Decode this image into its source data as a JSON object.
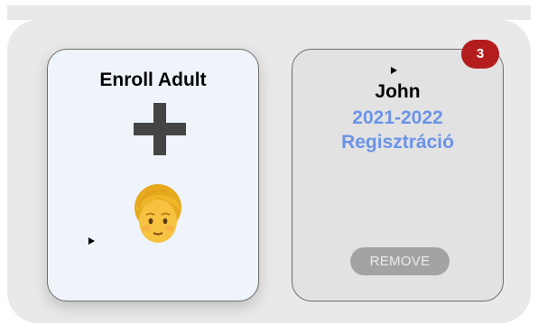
{
  "enroll_card": {
    "title": "Enroll Adult",
    "plus_icon": "plus-icon",
    "avatar_icon": "person-emoji-icon"
  },
  "person_card": {
    "name": "John",
    "year": "2021-2022",
    "status": "Regisztráció",
    "remove_label": "REMOVE",
    "badge_count": "3"
  },
  "colors": {
    "link_blue": "#6b93e8",
    "badge_red": "#b31d1d",
    "remove_gray": "#a3a3a3"
  }
}
